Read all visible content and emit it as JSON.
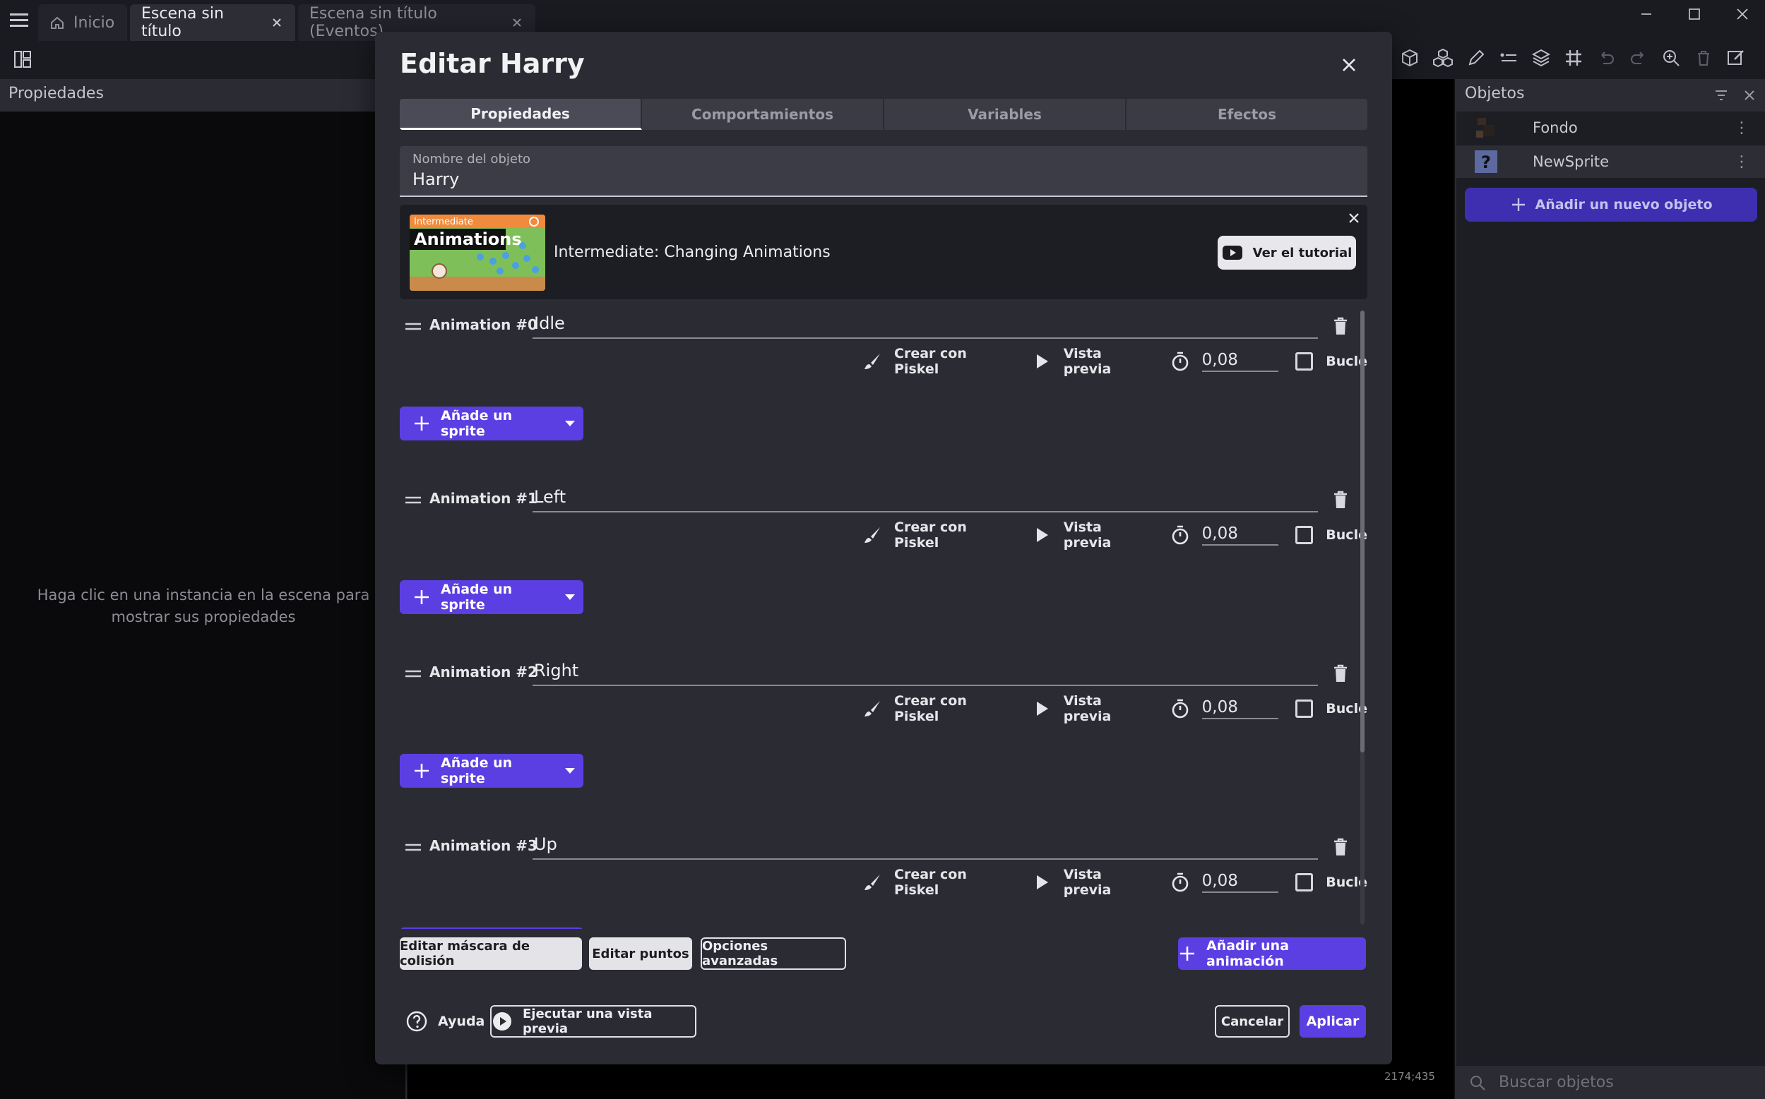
{
  "window": {
    "tabs": [
      {
        "label": "Inicio"
      },
      {
        "label": "Escena sin título"
      },
      {
        "label": "Escena sin título (Eventos)"
      }
    ]
  },
  "left_panel": {
    "title": "Propiedades",
    "hint": "Haga clic en una instancia en la escena para mostrar sus propiedades"
  },
  "objects_panel": {
    "title": "Objetos",
    "items": [
      {
        "name": "Fondo"
      },
      {
        "name": "NewSprite"
      }
    ],
    "add_label": "Añadir un nuevo objeto",
    "search_placeholder": "Buscar objetos"
  },
  "coords": "2174;435",
  "modal": {
    "title": "Editar Harry",
    "tabs": [
      {
        "label": "Propiedades",
        "active": true
      },
      {
        "label": "Comportamientos"
      },
      {
        "label": "Variables"
      },
      {
        "label": "Efectos"
      }
    ],
    "object_name_label": "Nombre del objeto",
    "object_name": "Harry",
    "tutorial": {
      "badge": "Intermediate",
      "thumb_title": "Animations",
      "title": "Intermediate: Changing Animations",
      "button": "Ver el tutorial"
    },
    "animations": [
      {
        "label": "Animation #0",
        "name": "Idle",
        "time": "0,08"
      },
      {
        "label": "Animation #1",
        "name": "Left",
        "time": "0,08"
      },
      {
        "label": "Animation #2",
        "name": "Right",
        "time": "0,08"
      },
      {
        "label": "Animation #3",
        "name": "Up",
        "time": "0,08"
      }
    ],
    "anim_tools": {
      "piskel": "Crear con Piskel",
      "preview": "Vista previa",
      "loop": "Bucle",
      "add_sprite": "Añade un sprite"
    },
    "buttons": {
      "collision": "Editar máscara de colisión",
      "points": "Editar puntos",
      "advanced": "Opciones avanzadas",
      "add_animation": "Añadir una animación",
      "help": "Ayuda",
      "run_preview": "Ejecutar una vista previa",
      "cancel": "Cancelar",
      "apply": "Aplicar"
    }
  },
  "colors": {
    "accent": "#5b3fe3",
    "modal_bg": "#2b2c33",
    "panel_bg": "#1d1e24"
  }
}
